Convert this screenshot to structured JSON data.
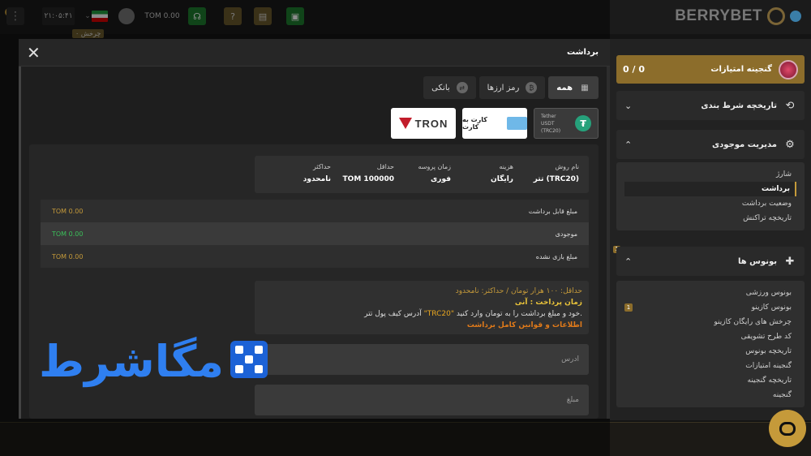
{
  "topbar": {
    "time": "۲۱:۰۵:۴۱",
    "balance": "TOM 0.00",
    "spin_badge": "چرخش ۰",
    "brand": "BERRYBET",
    "corner_badge": "0"
  },
  "sidebar": {
    "treasure_label": "گنجینه امتیازات",
    "treasure_score": "0 / 0",
    "history_label": "تاریخچه شرط بندی",
    "wallet_label": "مدیریت موجودی",
    "wallet_items": [
      "شارژ",
      "برداشت",
      "وضعیت برداشت",
      "تاریخچه تراکنش"
    ],
    "bonus_label": "بونوس ها",
    "bonus_section_badge": "1",
    "bonus_items": [
      "بونوس ورزشی",
      "بونوس کازینو",
      "چرخش های رایگان کازینو",
      "کد طرح تشویقی",
      "تاریخچه بونوس",
      "گنجینه امتیازات",
      "تاریخچه گنجینه",
      "گنجینه"
    ],
    "bonus_item_badge": "1"
  },
  "modal": {
    "title": "برداشت",
    "tabs": [
      {
        "label": "همه",
        "icon": "grid-icon",
        "active": true
      },
      {
        "label": "رمز ارزها",
        "icon": "bitcoin-icon",
        "active": false
      },
      {
        "label": "بانکی",
        "icon": "exchange-icon",
        "active": false
      }
    ],
    "methods": {
      "tether_line1": "Tether",
      "tether_line2": "USDT (TRC20)",
      "card_label": "کارت به کارت",
      "tron_label": "TRON"
    },
    "info": {
      "headers": {
        "method": "نام روش",
        "fee": "هزینه",
        "time": "زمان پروسه",
        "min": "حداقل",
        "max": "حداکثر"
      },
      "values": {
        "method": "تتر (TRC20)",
        "fee": "رایگان",
        "time": "فوری",
        "min": "TOM 100000",
        "max": "نامحدود"
      }
    },
    "balances": [
      {
        "label": "مبلغ قابل برداشت",
        "value": "TOM 0.00"
      },
      {
        "label": "موجودی",
        "value": "TOM 0.00"
      },
      {
        "label": "مبلغ بازی نشده",
        "value": "TOM 0.00"
      }
    ],
    "notice": {
      "line1": "حداقل: ۱۰۰ هزار تومان / حداکثر: نامحدود",
      "line2": "زمان پرداخت : آنی",
      "line3_pre": "آدرس کیف پول تتر ",
      "line3_hl": "\"TRC20\"",
      "line3_post": " خود و مبلغ برداشت را به تومان وارد کنید.",
      "line4": "اطلاعات و قوانین کامل برداشت"
    },
    "address_placeholder": "آدرس",
    "amount_placeholder": "مبلغ"
  },
  "watermark": {
    "text": "مگاشرط"
  }
}
